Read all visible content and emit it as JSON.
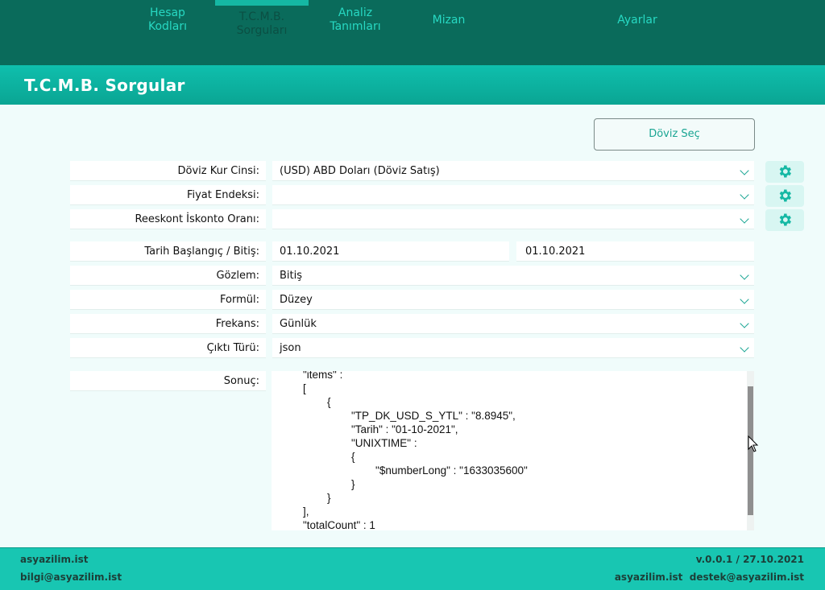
{
  "nav": {
    "tabs": [
      {
        "line1": "Hesap",
        "line2": "Kodları"
      },
      {
        "line1": "T.C.M.B.",
        "line2": "Sorguları"
      },
      {
        "line1": "Analiz",
        "line2": "Tanımları"
      },
      {
        "line1": "Mizan",
        "line2": ""
      },
      {
        "line1": "Ayarlar",
        "line2": ""
      }
    ],
    "active_index": 1
  },
  "page": {
    "title": "T.C.M.B. Sorgular"
  },
  "doviz_sec_button": "Döviz Seç",
  "form": {
    "doviz_kur": {
      "label": "Döviz Kur Cinsi:",
      "value": "(USD) ABD Doları (Döviz Satış)"
    },
    "fiyat_endeksi": {
      "label": "Fiyat Endeksi:",
      "value": ""
    },
    "reeskont": {
      "label": "Reeskont İskonto Oranı:",
      "value": ""
    },
    "tarih": {
      "label": "Tarih Başlangıç / Bitiş:",
      "start": "01.10.2021",
      "end": "01.10.2021"
    },
    "gozlem": {
      "label": "Gözlem:",
      "value": "Bitiş"
    },
    "formul": {
      "label": "Formül:",
      "value": "Düzey"
    },
    "frekans": {
      "label": "Frekans:",
      "value": "Günlük"
    },
    "cikti": {
      "label": "Çıktı Türü:",
      "value": "json"
    },
    "sonuc": {
      "label": "Sonuç:",
      "text": "        \"items\" :\n        [\n                {\n                        \"TP_DK_USD_S_YTL\" : \"8.8945\",\n                        \"Tarih\" : \"01-10-2021\",\n                        \"UNIXTIME\" :\n                        {\n                                \"$numberLong\" : \"1633035600\"\n                        }\n                }\n        ],\n        \"totalCount\" : 1"
    }
  },
  "footer": {
    "site": "asyazilim.ist",
    "email": "bilgi@asyazilim.ist",
    "version": "v.0.0.1 / 27.10.2021",
    "support_site": "asyazilim.ist",
    "support_email": "destek@asyazilim.ist"
  },
  "icons": {
    "gear": "gear-icon",
    "chevron": "chevron-down-icon"
  },
  "colors": {
    "nav_bg": "#0a6b5b",
    "accent": "#15b8a4",
    "footer_bg": "#18c6b2"
  }
}
